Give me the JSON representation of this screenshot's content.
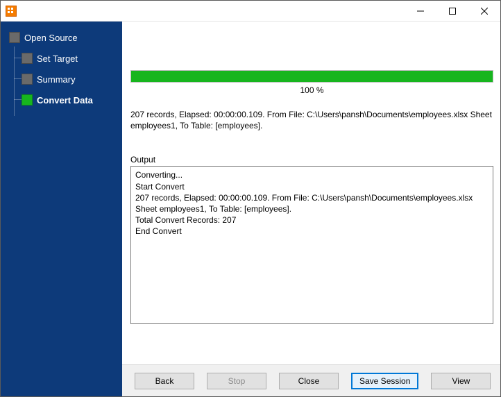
{
  "window": {
    "title": ""
  },
  "nav": {
    "items": [
      {
        "label": "Open Source",
        "active": false
      },
      {
        "label": "Set Target",
        "active": false
      },
      {
        "label": "Summary",
        "active": false
      },
      {
        "label": "Convert Data",
        "active": true
      }
    ]
  },
  "progress": {
    "percent_label": "100 %",
    "fill_pct": "100%",
    "fill_color": "#17b51e"
  },
  "status_text": "207 records,    Elapsed: 00:00:00.109.    From File: C:\\Users\\pansh\\Documents\\employees.xlsx Sheet employees1,    To Table: [employees].",
  "output": {
    "label": "Output",
    "text": "Converting...\nStart Convert\n207 records,    Elapsed: 00:00:00.109.    From File: C:\\Users\\pansh\\Documents\\employees.xlsx Sheet employees1,    To Table: [employees].\nTotal Convert Records: 207\nEnd Convert"
  },
  "buttons": {
    "back": "Back",
    "stop": "Stop",
    "close": "Close",
    "save_session": "Save Session",
    "view": "View"
  }
}
